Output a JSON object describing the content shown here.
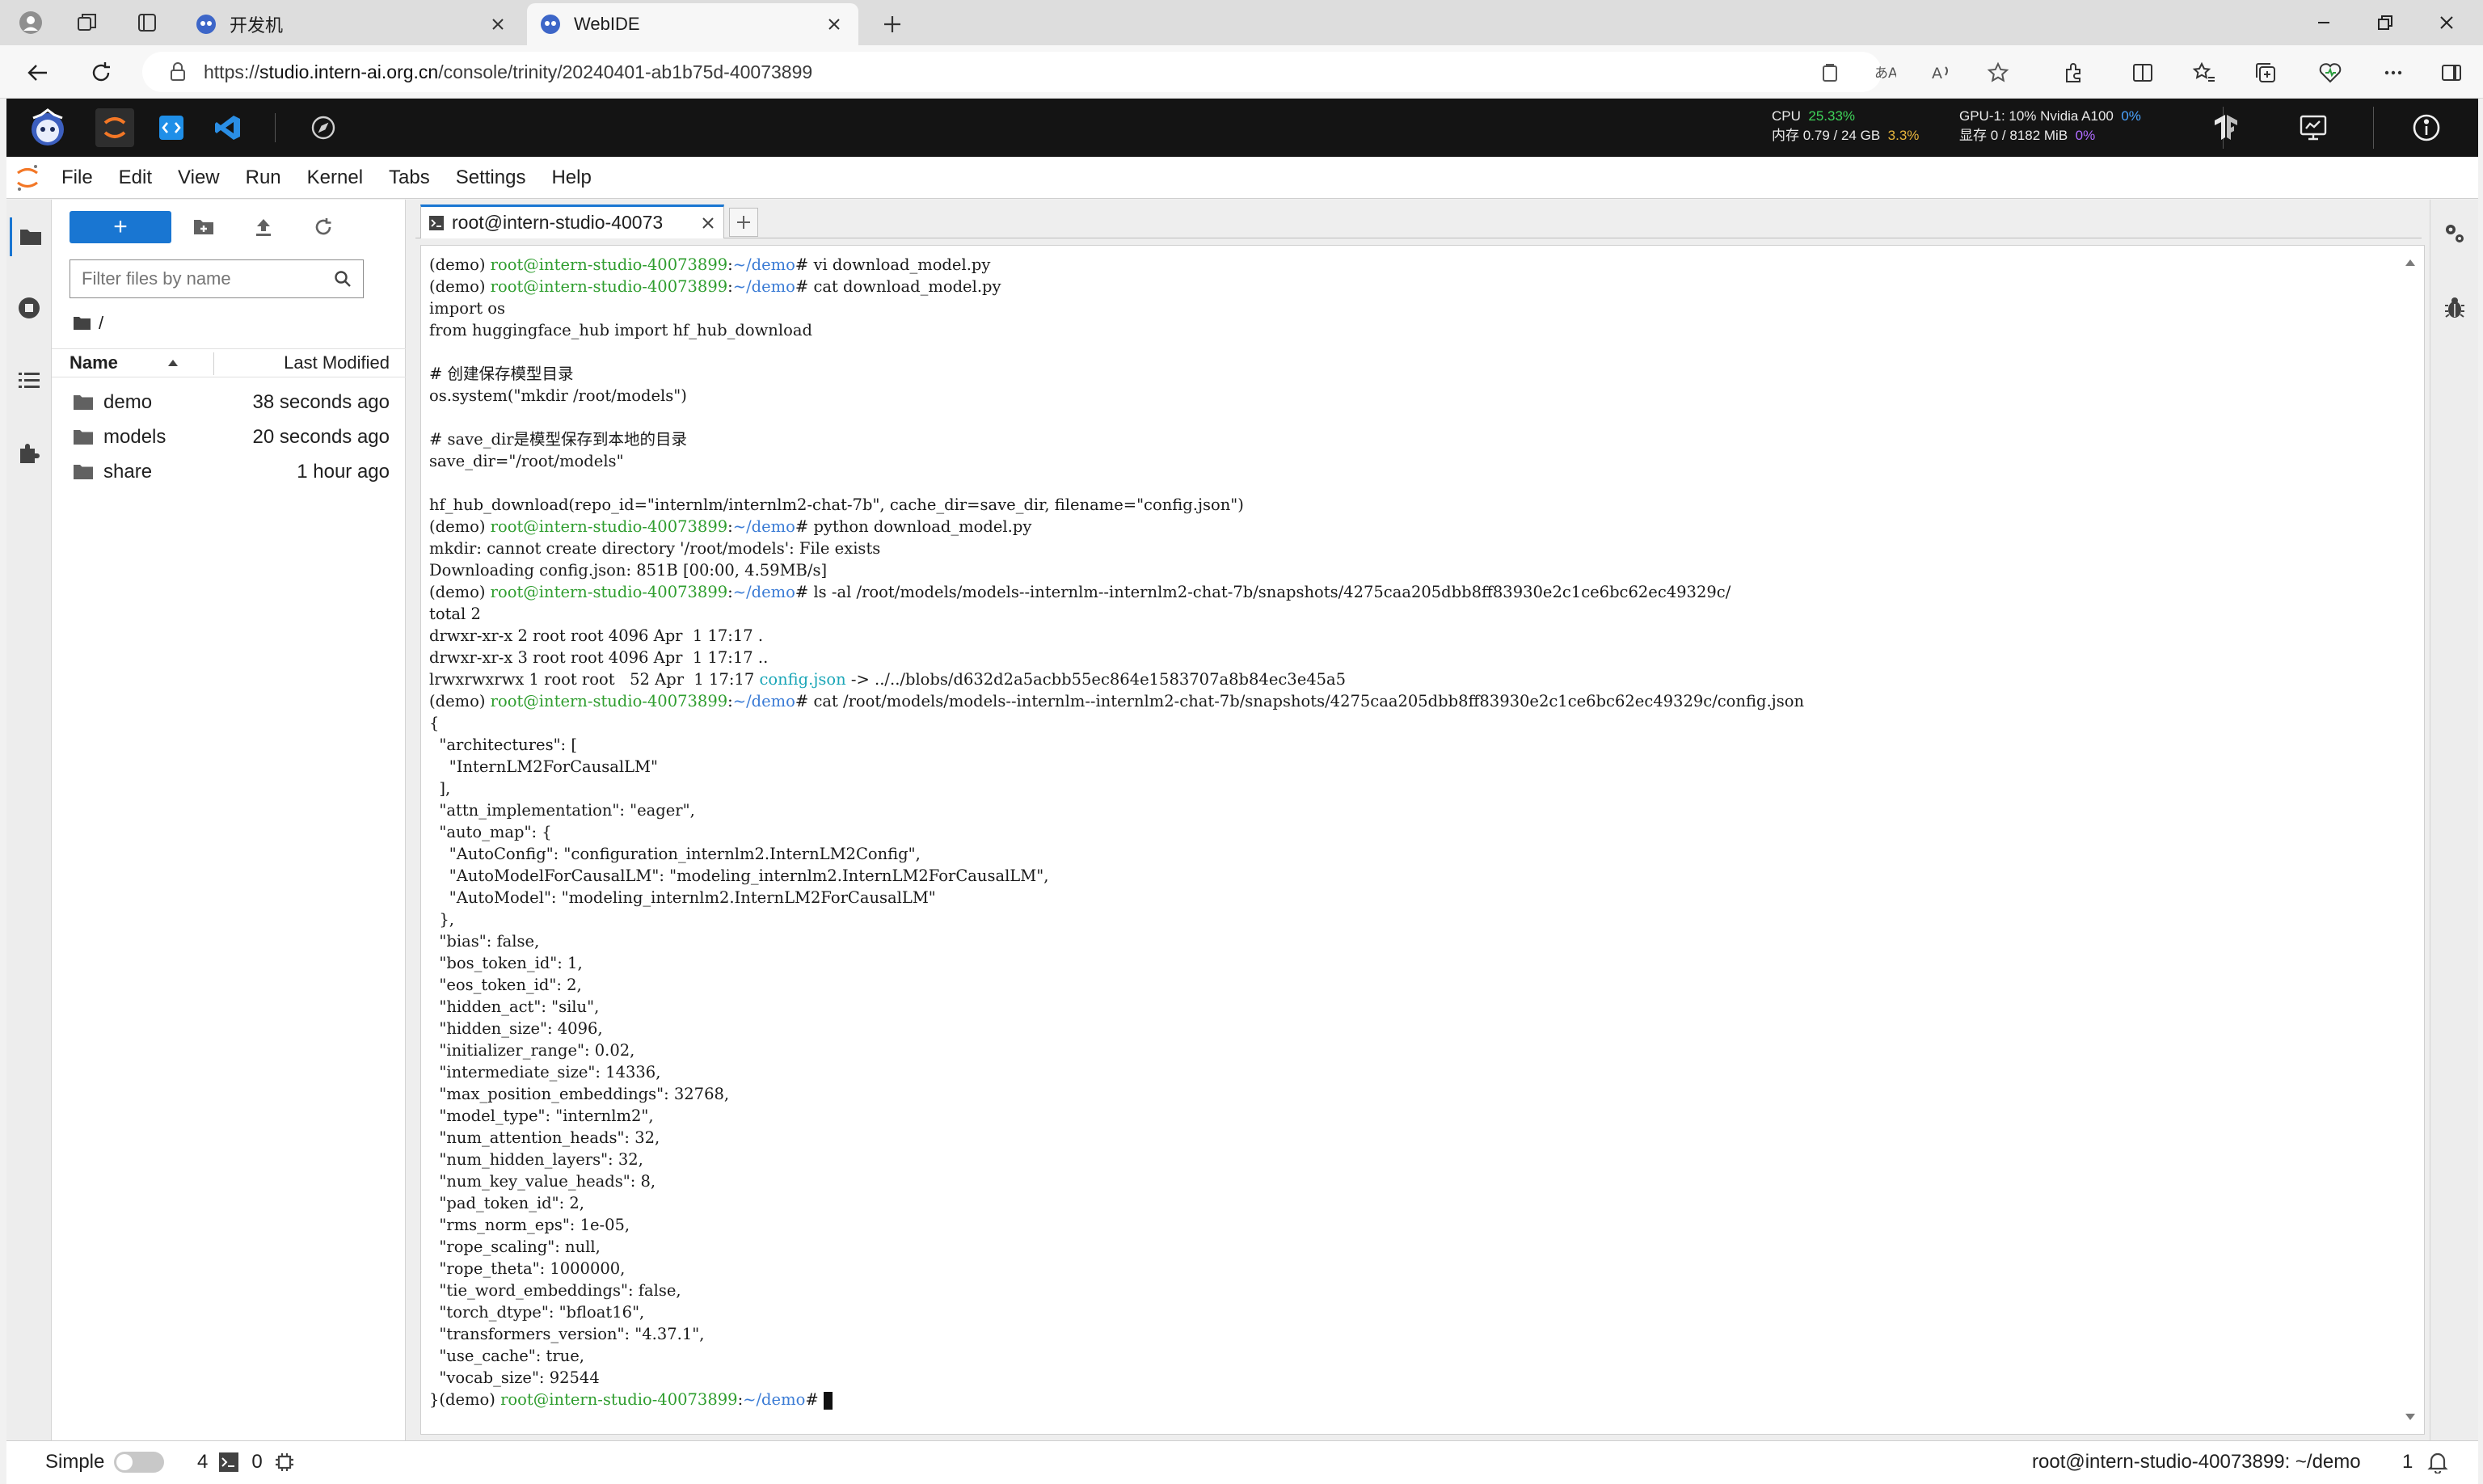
{
  "browser": {
    "tabs": [
      {
        "title": "开发机"
      },
      {
        "title": "WebIDE"
      }
    ],
    "url": {
      "scheme": "https://",
      "host": "studio.intern-ai.org.cn",
      "path": "/console/trinity/20240401-ab1b75d-40073899"
    }
  },
  "ide_header": {
    "cpu_label": "CPU",
    "cpu_value": "25.33%",
    "mem_label": "内存 0.79 / 24 GB",
    "mem_value": "3.3%",
    "gpu_label": "GPU-1: 10% Nvidia A100",
    "gpu_value": "0%",
    "vram_label": "显存 0 / 8182 MiB",
    "vram_value": "0%"
  },
  "menu": [
    "File",
    "Edit",
    "View",
    "Run",
    "Kernel",
    "Tabs",
    "Settings",
    "Help"
  ],
  "filebrowser": {
    "new_label": "+",
    "filter_placeholder": "Filter files by name",
    "breadcrumb": "/",
    "col_name": "Name",
    "col_modified": "Last Modified",
    "files": [
      {
        "name": "demo",
        "modified": "38 seconds ago"
      },
      {
        "name": "models",
        "modified": "20 seconds ago"
      },
      {
        "name": "share",
        "modified": "1 hour ago"
      }
    ]
  },
  "terminal": {
    "tab_title": "root@intern-studio-40073",
    "lines": [
      [
        {
          "t": "(demo) "
        },
        {
          "t": "root@intern-studio-40073899",
          "c": "gr"
        },
        {
          "t": ":"
        },
        {
          "t": "~/demo",
          "c": "bl"
        },
        {
          "t": "# vi download_model.py"
        }
      ],
      [
        {
          "t": "(demo) "
        },
        {
          "t": "root@intern-studio-40073899",
          "c": "gr"
        },
        {
          "t": ":"
        },
        {
          "t": "~/demo",
          "c": "bl"
        },
        {
          "t": "# cat download_model.py"
        }
      ],
      [
        {
          "t": "import os"
        }
      ],
      [
        {
          "t": "from huggingface_hub import hf_hub_download"
        }
      ],
      [
        {
          "t": ""
        }
      ],
      [
        {
          "t": "# 创建保存模型目录"
        }
      ],
      [
        {
          "t": "os.system(\"mkdir /root/models\")"
        }
      ],
      [
        {
          "t": ""
        }
      ],
      [
        {
          "t": "# save_dir是模型保存到本地的目录"
        }
      ],
      [
        {
          "t": "save_dir=\"/root/models\""
        }
      ],
      [
        {
          "t": ""
        }
      ],
      [
        {
          "t": "hf_hub_download(repo_id=\"internlm/internlm2-chat-7b\", cache_dir=save_dir, filename=\"config.json\")"
        }
      ],
      [
        {
          "t": "(demo) "
        },
        {
          "t": "root@intern-studio-40073899",
          "c": "gr"
        },
        {
          "t": ":"
        },
        {
          "t": "~/demo",
          "c": "bl"
        },
        {
          "t": "# python download_model.py"
        }
      ],
      [
        {
          "t": "mkdir: cannot create directory '/root/models': File exists"
        }
      ],
      [
        {
          "t": "Downloading config.json: 851B [00:00, 4.59MB/s]"
        }
      ],
      [
        {
          "t": "(demo) "
        },
        {
          "t": "root@intern-studio-40073899",
          "c": "gr"
        },
        {
          "t": ":"
        },
        {
          "t": "~/demo",
          "c": "bl"
        },
        {
          "t": "# ls -al /root/models/models--internlm--internlm2-chat-7b/snapshots/4275caa205dbb8ff83930e2c1ce6bc62ec49329c/"
        }
      ],
      [
        {
          "t": "total 2"
        }
      ],
      [
        {
          "t": "drwxr-xr-x 2 root root 4096 Apr  1 17:17 ."
        }
      ],
      [
        {
          "t": "drwxr-xr-x 3 root root 4096 Apr  1 17:17 .."
        }
      ],
      [
        {
          "t": "lrwxrwxrwx 1 root root   52 Apr  1 17:17 "
        },
        {
          "t": "config.json",
          "c": "cy"
        },
        {
          "t": " -> ../../blobs/d632d2a5acbb55ec864e1583707a8b84ec3e45a5"
        }
      ],
      [
        {
          "t": "(demo) "
        },
        {
          "t": "root@intern-studio-40073899",
          "c": "gr"
        },
        {
          "t": ":"
        },
        {
          "t": "~/demo",
          "c": "bl"
        },
        {
          "t": "# cat /root/models/models--internlm--internlm2-chat-7b/snapshots/4275caa205dbb8ff83930e2c1ce6bc62ec49329c/config.json"
        }
      ],
      [
        {
          "t": "{"
        }
      ],
      [
        {
          "t": "  \"architectures\": ["
        }
      ],
      [
        {
          "t": "    \"InternLM2ForCausalLM\""
        }
      ],
      [
        {
          "t": "  ],"
        }
      ],
      [
        {
          "t": "  \"attn_implementation\": \"eager\","
        }
      ],
      [
        {
          "t": "  \"auto_map\": {"
        }
      ],
      [
        {
          "t": "    \"AutoConfig\": \"configuration_internlm2.InternLM2Config\","
        }
      ],
      [
        {
          "t": "    \"AutoModelForCausalLM\": \"modeling_internlm2.InternLM2ForCausalLM\","
        }
      ],
      [
        {
          "t": "    \"AutoModel\": \"modeling_internlm2.InternLM2ForCausalLM\""
        }
      ],
      [
        {
          "t": "  },"
        }
      ],
      [
        {
          "t": "  \"bias\": false,"
        }
      ],
      [
        {
          "t": "  \"bos_token_id\": 1,"
        }
      ],
      [
        {
          "t": "  \"eos_token_id\": 2,"
        }
      ],
      [
        {
          "t": "  \"hidden_act\": \"silu\","
        }
      ],
      [
        {
          "t": "  \"hidden_size\": 4096,"
        }
      ],
      [
        {
          "t": "  \"initializer_range\": 0.02,"
        }
      ],
      [
        {
          "t": "  \"intermediate_size\": 14336,"
        }
      ],
      [
        {
          "t": "  \"max_position_embeddings\": 32768,"
        }
      ],
      [
        {
          "t": "  \"model_type\": \"internlm2\","
        }
      ],
      [
        {
          "t": "  \"num_attention_heads\": 32,"
        }
      ],
      [
        {
          "t": "  \"num_hidden_layers\": 32,"
        }
      ],
      [
        {
          "t": "  \"num_key_value_heads\": 8,"
        }
      ],
      [
        {
          "t": "  \"pad_token_id\": 2,"
        }
      ],
      [
        {
          "t": "  \"rms_norm_eps\": 1e-05,"
        }
      ],
      [
        {
          "t": "  \"rope_scaling\": null,"
        }
      ],
      [
        {
          "t": "  \"rope_theta\": 1000000,"
        }
      ],
      [
        {
          "t": "  \"tie_word_embeddings\": false,"
        }
      ],
      [
        {
          "t": "  \"torch_dtype\": \"bfloat16\","
        }
      ],
      [
        {
          "t": "  \"transformers_version\": \"4.37.1\","
        }
      ],
      [
        {
          "t": "  \"use_cache\": true,"
        }
      ],
      [
        {
          "t": "  \"vocab_size\": 92544"
        }
      ],
      [
        {
          "t": "}(demo) "
        },
        {
          "t": "root@intern-studio-40073899",
          "c": "gr"
        },
        {
          "t": ":"
        },
        {
          "t": "~/demo",
          "c": "bl"
        },
        {
          "t": "# "
        },
        {
          "t": "",
          "c": "cursor"
        }
      ]
    ]
  },
  "statusbar": {
    "mode_label": "Simple",
    "terminals_count": "4",
    "kernels_count": "0",
    "cwd_label": "root@intern-studio-40073899: ~/demo",
    "notifications_count": "1"
  }
}
